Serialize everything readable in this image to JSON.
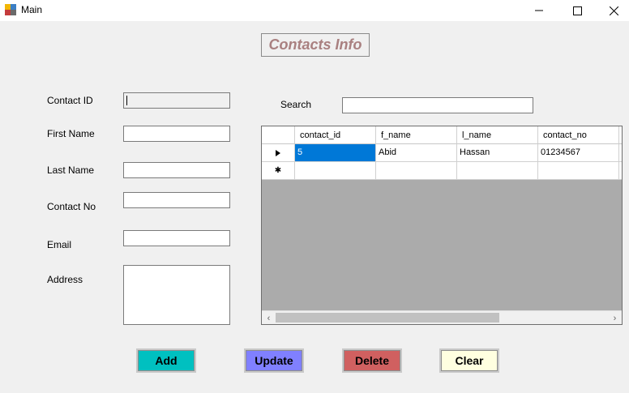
{
  "window": {
    "title": "Main"
  },
  "header": {
    "title": "Contacts Info"
  },
  "form": {
    "contact_id_label": "Contact ID",
    "first_name_label": "First Name",
    "last_name_label": "Last Name",
    "contact_no_label": "Contact No",
    "email_label": "Email",
    "address_label": "Address"
  },
  "search": {
    "label": "Search",
    "value": ""
  },
  "grid": {
    "columns": [
      "contact_id",
      "f_name",
      "l_name",
      "contact_no"
    ],
    "rows": [
      [
        "5",
        "Abid",
        "Hassan",
        "01234567"
      ]
    ],
    "selected_cell": "0.0"
  },
  "buttons": {
    "add": "Add",
    "update": "Update",
    "delete": "Delete",
    "clear": "Clear"
  },
  "colors": {
    "add": "#00c0c0",
    "update": "#8080ff",
    "delete": "#d06060",
    "clear": "#ffffe0",
    "header_text": "#a98080",
    "selection": "#0078d7"
  }
}
